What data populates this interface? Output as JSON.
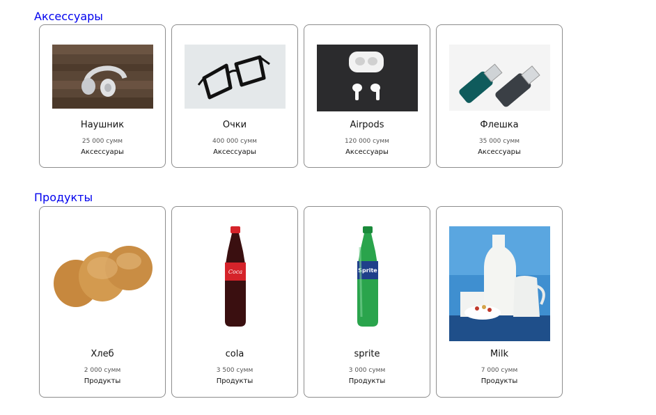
{
  "sections": [
    {
      "title": "Аксессуары",
      "items": [
        {
          "name": "Наушник",
          "price": "25 000 сумм",
          "category": "Аксессуары",
          "image": "headphones-image"
        },
        {
          "name": "Очки",
          "price": "400 000 сумм",
          "category": "Аксессуары",
          "image": "glasses-image"
        },
        {
          "name": "Airpods",
          "price": "120 000 сумм",
          "category": "Аксессуары",
          "image": "airpods-image"
        },
        {
          "name": "Флешка",
          "price": "35 000 сумм",
          "category": "Аксессуары",
          "image": "usb-flash-image"
        }
      ]
    },
    {
      "title": "Продукты",
      "items": [
        {
          "name": "Хлеб",
          "price": "2 000 сумм",
          "category": "Продукты",
          "image": "bread-image"
        },
        {
          "name": "cola",
          "price": "3 500 сумм",
          "category": "Продукты",
          "image": "cola-bottle-image"
        },
        {
          "name": "sprite",
          "price": "3 000 сумм",
          "category": "Продукты",
          "image": "sprite-bottle-image"
        },
        {
          "name": "Milk",
          "price": "7 000 сумм",
          "category": "Продукты",
          "image": "milk-image"
        }
      ]
    }
  ]
}
